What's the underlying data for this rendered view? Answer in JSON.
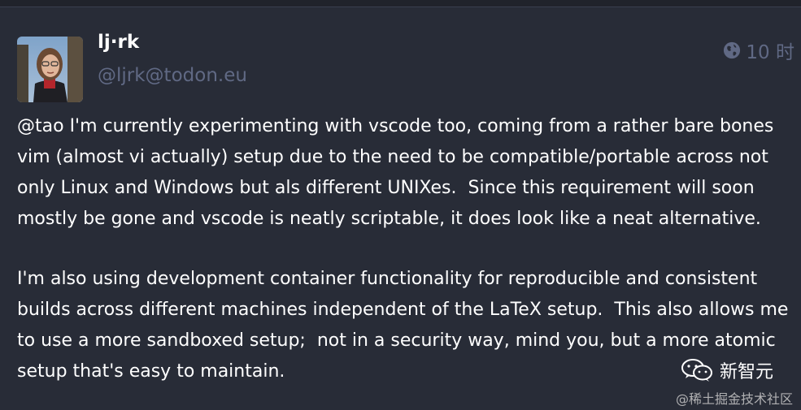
{
  "status": {
    "display_name": "lj·rk",
    "account": "@ljrk@todon.eu",
    "visibility_icon": "globe-icon",
    "time": "10 时",
    "mention": "@tao",
    "paragraphs": [
      " I'm currently experimenting with vscode too, coming from a rather bare bones\nvim (almost vi actually) setup due to the need to be compatible/portable across not\nonly Linux and Windows but als different UNIXes.  Since this requirement will soon\nmostly be gone and vscode is neatly scriptable, it does look like a neat alternative.",
      "I'm also using development container functionality for reproducible and consistent\nbuilds across different machines independent of the LaTeX setup.  This also allows me\nto use a more sandboxed setup;  not in a security way, mind you, but a more atomic\nsetup that's easy to maintain."
    ]
  },
  "watermark": {
    "brand": "新智元",
    "sub": "@稀土掘金技术社区",
    "icon": "wechat-icon"
  },
  "colors": {
    "background": "#282c37",
    "muted": "#606984",
    "text": "#ffffff"
  }
}
